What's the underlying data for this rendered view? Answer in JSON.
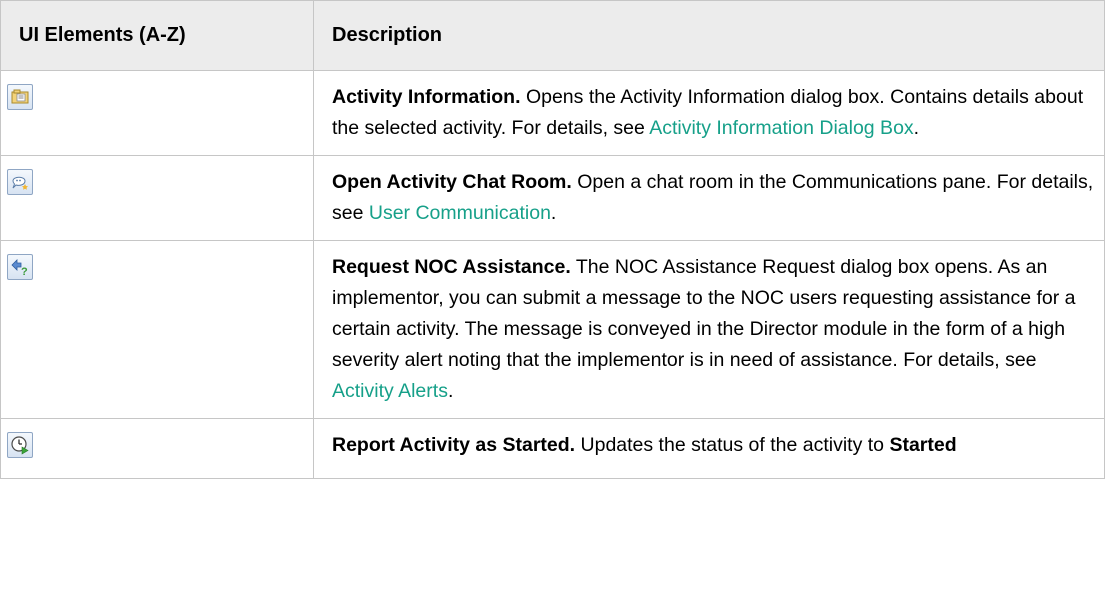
{
  "header": {
    "col1": "UI Elements (A-Z)",
    "col2": "Description"
  },
  "rows": [
    {
      "icon": "activity-information-icon",
      "title": "Activity Information.",
      "text_before": " Opens the Activity Information dialog box. Contains details about the selected activity. For details, see ",
      "link": "Activity Information Dialog Box",
      "text_after": "."
    },
    {
      "icon": "chat-room-icon",
      "title": "Open Activity Chat Room.",
      "text_before": " Open a chat room in the Communications pane. For details, see ",
      "link": "User Communication",
      "text_after": "."
    },
    {
      "icon": "request-assistance-icon",
      "title": "Request NOC Assistance.",
      "text_before": " The NOC Assistance Request dialog box opens. As an implementor, you can submit a message to the NOC users requesting assistance for a certain activity. The message is conveyed in the Director module in the form of a high severity alert noting that the implementor is in need of assistance. For details, see ",
      "link": "Activity Alerts",
      "text_after": "."
    },
    {
      "icon": "report-started-icon",
      "title": "Report Activity as Started.",
      "text_before": " Updates the status of the activity to ",
      "bold_end": "Started"
    }
  ],
  "colors": {
    "link": "#16a089",
    "header_bg": "#ececec",
    "border": "#c6c6c6"
  }
}
